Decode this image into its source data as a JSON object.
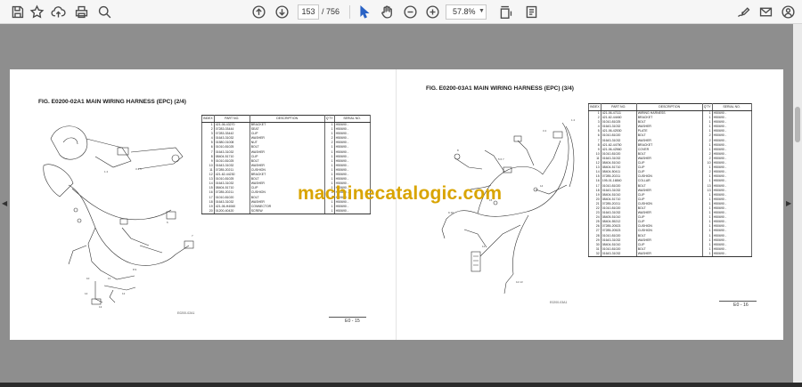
{
  "toolbar": {
    "page_current": "153",
    "page_separator": "/",
    "page_total": "756",
    "zoom": "57.8%",
    "icons": [
      "save-icon",
      "bookmark-star-icon",
      "cloud-upload-icon",
      "print-icon",
      "zoom-search-icon",
      "page-up-icon",
      "page-down-icon",
      "select-cursor-icon",
      "hand-pan-icon",
      "zoom-out-icon",
      "zoom-in-icon",
      "fit-page-icon",
      "display-mode-icon",
      "sign-icon",
      "mail-icon",
      "share-icon"
    ]
  },
  "watermark": "machinecatalogic.com",
  "left_page": {
    "title": "FIG. E0200-02A1     MAIN WIRING HARNESS (EPC) (2/4)",
    "headers": {
      "index": "INDEX",
      "part_no": "PART NO.",
      "description": "DESCRIPTION",
      "qty": "Q'TY",
      "serial": "SERIAL NO."
    },
    "rows": [
      {
        "index": "1",
        "part_no": "421-06-43270",
        "description": "BRACKET",
        "qty": "1",
        "serial": "H50690 -"
      },
      {
        "index": "2",
        "part_no": "07283-03444",
        "description": "SEAT",
        "qty": "1",
        "serial": "H50690 -"
      },
      {
        "index": "3",
        "part_no": "07283-33442",
        "description": "CLIP",
        "qty": "1",
        "serial": "H50690 -"
      },
      {
        "index": "4",
        "part_no": "01643-31032",
        "description": "WASHER",
        "qty": "2",
        "serial": "H50690 -"
      },
      {
        "index": "5",
        "part_no": "01580-01008",
        "description": "NUT",
        "qty": "2",
        "serial": "H50690 -"
      },
      {
        "index": "6",
        "part_no": "01010-81025",
        "description": "BOLT",
        "qty": "1",
        "serial": "H50690 -"
      },
      {
        "index": "7",
        "part_no": "01643-31032",
        "description": "WASHER",
        "qty": "1",
        "serial": "H50690 -"
      },
      {
        "index": "8",
        "part_no": "08404-51710",
        "description": "CLIP",
        "qty": "1",
        "serial": "H50690 -"
      },
      {
        "index": "9",
        "part_no": "01010-81025",
        "description": "BOLT",
        "qty": "1",
        "serial": "H50690 -"
      },
      {
        "index": "10",
        "part_no": "01643-31032",
        "description": "WASHER",
        "qty": "1",
        "serial": "H50690 -"
      },
      {
        "index": "11",
        "part_no": "07285-20211",
        "description": "CUSHION",
        "qty": "1",
        "serial": "H50690 -"
      },
      {
        "index": "12",
        "part_no": "421-62-44230",
        "description": "BRACKET",
        "qty": "1",
        "serial": "H50690 -"
      },
      {
        "index": "13",
        "part_no": "01010-81025",
        "description": "BOLT",
        "qty": "1",
        "serial": "H50690 -"
      },
      {
        "index": "14",
        "part_no": "01643-31032",
        "description": "WASHER",
        "qty": "1",
        "serial": "H50690 -"
      },
      {
        "index": "15",
        "part_no": "08404-51710",
        "description": "CLIP",
        "qty": "1",
        "serial": "H50690 -"
      },
      {
        "index": "16",
        "part_no": "07285-20211",
        "description": "CUSHION",
        "qty": "1",
        "serial": "H50690 -"
      },
      {
        "index": "17",
        "part_no": "01010-81020",
        "description": "BOLT",
        "qty": "1",
        "serial": "H50690 -"
      },
      {
        "index": "18",
        "part_no": "01643-31032",
        "description": "WASHER",
        "qty": "1",
        "serial": "H50690 -"
      },
      {
        "index": "19",
        "part_no": "421-06-H4060",
        "description": "CONNECTOR",
        "qty": "1",
        "serial": "H50690 -"
      },
      {
        "index": "20",
        "part_no": "01200-40420",
        "description": "SCREW",
        "qty": "1",
        "serial": "H50690 -"
      }
    ],
    "footer": "E0 -  15"
  },
  "right_page": {
    "title": "FIG. E0200-03A1     MAIN WIRING HARNESS (EPC) (3/4)",
    "headers": {
      "index": "INDEX",
      "part_no": "PART NO.",
      "description": "DESCRIPTION",
      "qty": "Q'TY",
      "serial": "SERIAL NO."
    },
    "rows": [
      {
        "index": "1",
        "part_no": "421-06-47111",
        "description": "WIRING HARNESS",
        "qty": "1",
        "serial": "H50690 -"
      },
      {
        "index": "2",
        "part_no": "421-62-44460",
        "description": "BRACKET",
        "qty": "1",
        "serial": "H50690 -"
      },
      {
        "index": "3",
        "part_no": "01010-81025",
        "description": "BOLT",
        "qty": "1",
        "serial": "H50690 -"
      },
      {
        "index": "4",
        "part_no": "01643-31032",
        "description": "WASHER",
        "qty": "1",
        "serial": "H50690 -"
      },
      {
        "index": "5",
        "part_no": "421-06-42530",
        "description": "PLATE",
        "qty": "1",
        "serial": "H50690 -"
      },
      {
        "index": "6",
        "part_no": "01010-81020",
        "description": "BOLT",
        "qty": "2",
        "serial": "H50690 -"
      },
      {
        "index": "7",
        "part_no": "01643-31032",
        "description": "WASHER",
        "qty": "2",
        "serial": "H50690 -"
      },
      {
        "index": "8",
        "part_no": "421-62-44750",
        "description": "BRACKET",
        "qty": "1",
        "serial": "H50690 -"
      },
      {
        "index": "9",
        "part_no": "421-06-42560",
        "description": "COVER",
        "qty": "1",
        "serial": "H50690 -"
      },
      {
        "index": "10",
        "part_no": "01010-81020",
        "description": "BOLT",
        "qty": "2",
        "serial": "H50690 -"
      },
      {
        "index": "11",
        "part_no": "01643-31032",
        "description": "WASHER",
        "qty": "2",
        "serial": "H50690 -"
      },
      {
        "index": "12",
        "part_no": "08404-51010",
        "description": "CLIP",
        "qty": "10",
        "serial": "H50690 -"
      },
      {
        "index": "13",
        "part_no": "08404-51710",
        "description": "CLIP",
        "qty": "1",
        "serial": "H50690 -"
      },
      {
        "index": "14",
        "part_no": "08404-50411",
        "description": "CLIP",
        "qty": "2",
        "serial": "H50690 -"
      },
      {
        "index": "15",
        "part_no": "07285-20211",
        "description": "CUSHION",
        "qty": "1",
        "serial": "H50690 -"
      },
      {
        "index": "16",
        "part_no": "195-01-16840",
        "description": "COLLAR",
        "qty": "1",
        "serial": "H50690 -"
      },
      {
        "index": "17",
        "part_no": "01010-81020",
        "description": "BOLT",
        "qty": "13",
        "serial": "H50690 -"
      },
      {
        "index": "18",
        "part_no": "01643-31032",
        "description": "WASHER",
        "qty": "13",
        "serial": "H50690 -"
      },
      {
        "index": "19",
        "part_no": "08404-51010",
        "description": "CLIP",
        "qty": "1",
        "serial": "H50690 -"
      },
      {
        "index": "20",
        "part_no": "08404-51710",
        "description": "CLIP",
        "qty": "1",
        "serial": "H50690 -"
      },
      {
        "index": "21",
        "part_no": "07285-20211",
        "description": "CUSHION",
        "qty": "1",
        "serial": "H50690 -"
      },
      {
        "index": "22",
        "part_no": "01010-81020",
        "description": "BOLT",
        "qty": "1",
        "serial": "H50690 -"
      },
      {
        "index": "23",
        "part_no": "01643-31032",
        "description": "WASHER",
        "qty": "1",
        "serial": "H50690 -"
      },
      {
        "index": "24",
        "part_no": "08405-51010",
        "description": "CLIP",
        "qty": "1",
        "serial": "H50690 -"
      },
      {
        "index": "25",
        "part_no": "08404-55212",
        "description": "CLIP",
        "qty": "1",
        "serial": "H50690 -"
      },
      {
        "index": "26",
        "part_no": "07285-20523",
        "description": "CUSHION",
        "qty": "1",
        "serial": "H50690 -"
      },
      {
        "index": "27",
        "part_no": "07285-20523",
        "description": "CUSHION",
        "qty": "1",
        "serial": "H50690 -"
      },
      {
        "index": "28",
        "part_no": "01010-81020",
        "description": "BOLT",
        "qty": "1",
        "serial": "H50690 -"
      },
      {
        "index": "29",
        "part_no": "01643-31032",
        "description": "WASHER",
        "qty": "1",
        "serial": "H50690 -"
      },
      {
        "index": "30",
        "part_no": "08404-51010",
        "description": "CLIP",
        "qty": "1",
        "serial": "H50690 -"
      },
      {
        "index": "31",
        "part_no": "01010-81020",
        "description": "BOLT",
        "qty": "1",
        "serial": "H50690 -"
      },
      {
        "index": "32",
        "part_no": "01643-31032",
        "description": "WASHER",
        "qty": "1",
        "serial": "H50690 -"
      }
    ],
    "footer": "E0 -  16"
  },
  "figure_codes": {
    "left": "E0200-02A1",
    "right": "E0200-03A1"
  },
  "colors": {
    "toolbar_bg": "#f6f6f6",
    "viewer_bg": "#8e8e8e",
    "page_bg": "#ffffff",
    "watermark": "#d9a400"
  }
}
